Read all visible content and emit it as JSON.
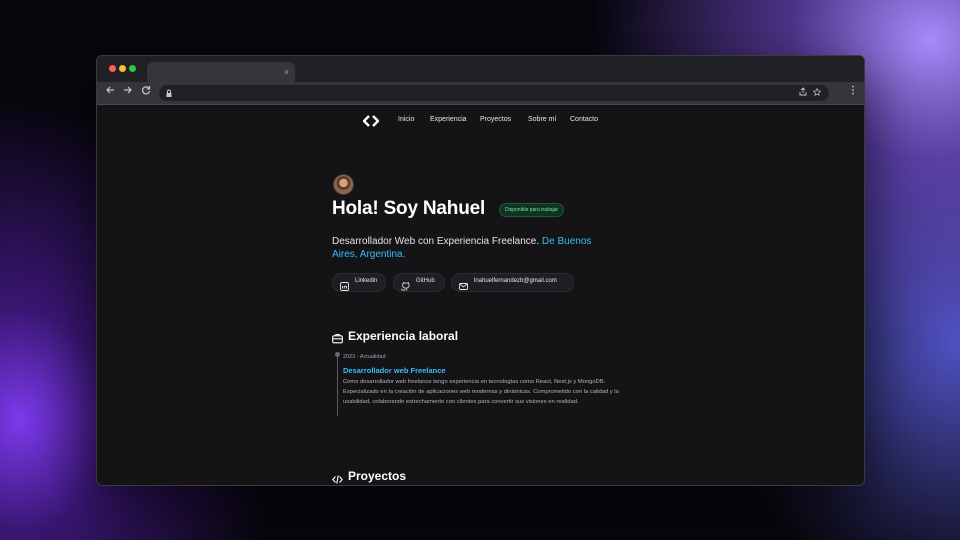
{
  "browser": {
    "tab_close": "×",
    "toolbar_icons": [
      "back-icon",
      "forward-icon",
      "reload-icon",
      "lock-icon",
      "share-icon",
      "star-icon",
      "menu-icon"
    ]
  },
  "nav": {
    "links": [
      "Inicio",
      "Experiencia",
      "Proyectos",
      "Sobre mí",
      "Contacto"
    ]
  },
  "hero": {
    "title": "Hola! Soy Nahuel",
    "badge": "Disponible para trabajar",
    "subtitle_text": "Desarrollador Web con Experiencia Freelance. ",
    "subtitle_location": "De Buenos Aires, Argentina.",
    "buttons": [
      "Linkedin",
      "GitHub",
      "lnahuelfernandezb@gmail.com"
    ]
  },
  "experience": {
    "title": "Experiencia laboral",
    "items": [
      {
        "date": "2023 - Actualidad",
        "role": "Desarrollador web Freelance",
        "description": "Como desarrollador web freelance tengo experiencia en tecnologías como React, Next.js y MongoDB. Especializado en la creación de aplicaciones web modernas y dinámicas. Comprometido con la calidad y la usabilidad, colaborando estrechamente con clientes para convertir sus visiones en realidad."
      }
    ]
  },
  "projects": {
    "title": "Proyectos"
  },
  "colors": {
    "accent": "#38bdf8",
    "badge_text": "#7ee2a8",
    "page_bg": "#141416"
  }
}
